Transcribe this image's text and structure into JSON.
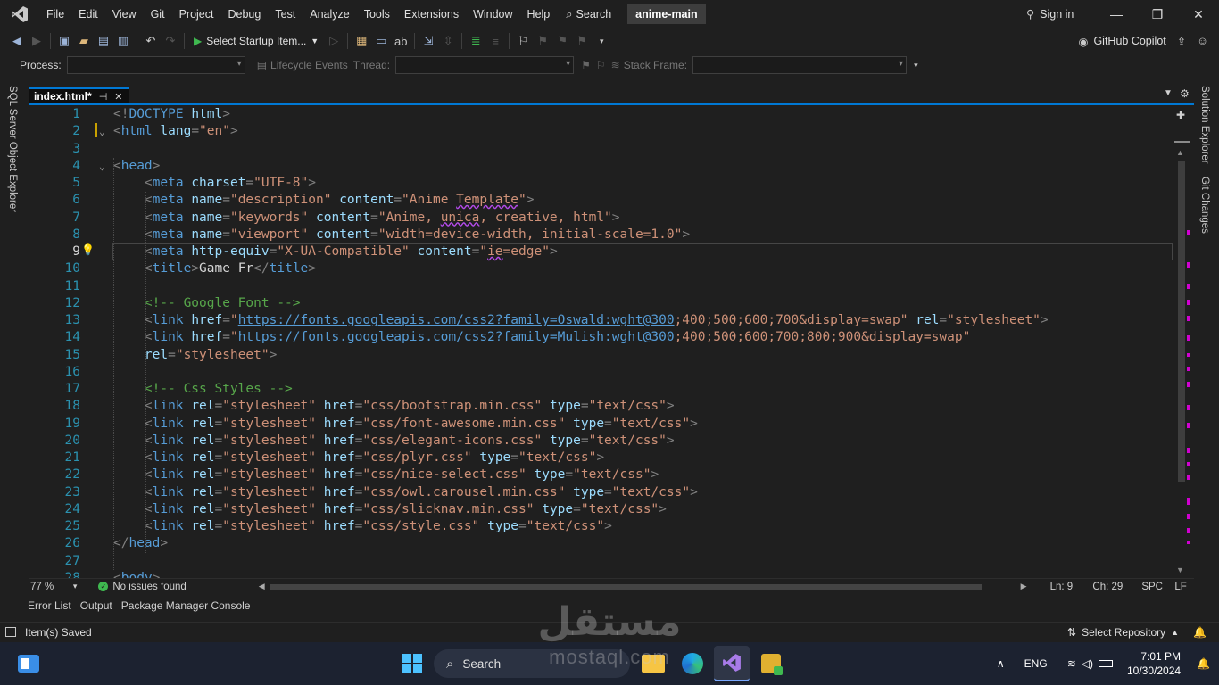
{
  "menubar": {
    "items": [
      "File",
      "Edit",
      "View",
      "Git",
      "Project",
      "Debug",
      "Test",
      "Analyze",
      "Tools",
      "Extensions",
      "Window",
      "Help"
    ],
    "search_label": "Search",
    "solution_name": "anime-main",
    "signin_label": "Sign in"
  },
  "toolbar": {
    "startup_label": "Select Startup Item...",
    "copilot_label": "GitHub Copilot"
  },
  "debugbar": {
    "process_label": "Process:",
    "lifecycle_label": "Lifecycle Events",
    "thread_label": "Thread:",
    "stackframe_label": "Stack Frame:"
  },
  "rails": {
    "left": "SQL Server Object Explorer",
    "right_1": "Solution Explorer",
    "right_2": "Git Changes"
  },
  "tab": {
    "label": "index.html*"
  },
  "editor": {
    "current_line": 9,
    "lines": [
      [
        [
          "p",
          "<!"
        ],
        [
          "t",
          "DOCTYPE"
        ],
        [
          "x",
          " "
        ],
        [
          "a",
          "html"
        ],
        [
          "p",
          ">"
        ]
      ],
      [
        [
          "p",
          "<"
        ],
        [
          "t",
          "html"
        ],
        [
          "x",
          " "
        ],
        [
          "a",
          "lang"
        ],
        [
          "p",
          "="
        ],
        [
          "v",
          "\"en\""
        ],
        [
          "p",
          ">"
        ]
      ],
      [],
      [
        [
          "p",
          "<"
        ],
        [
          "t",
          "head"
        ],
        [
          "p",
          ">"
        ]
      ],
      [
        [
          "x",
          "    "
        ],
        [
          "p",
          "<"
        ],
        [
          "t",
          "meta"
        ],
        [
          "x",
          " "
        ],
        [
          "a",
          "charset"
        ],
        [
          "p",
          "="
        ],
        [
          "v",
          "\"UTF-8\""
        ],
        [
          "p",
          ">"
        ]
      ],
      [
        [
          "x",
          "    "
        ],
        [
          "p",
          "<"
        ],
        [
          "t",
          "meta"
        ],
        [
          "x",
          " "
        ],
        [
          "a",
          "name"
        ],
        [
          "p",
          "="
        ],
        [
          "v",
          "\"description\""
        ],
        [
          "x",
          " "
        ],
        [
          "a",
          "content"
        ],
        [
          "p",
          "="
        ],
        [
          "v",
          "\"Anime "
        ],
        [
          "vs",
          "Template"
        ],
        [
          "v",
          "\""
        ],
        [
          "p",
          ">"
        ]
      ],
      [
        [
          "x",
          "    "
        ],
        [
          "p",
          "<"
        ],
        [
          "t",
          "meta"
        ],
        [
          "x",
          " "
        ],
        [
          "a",
          "name"
        ],
        [
          "p",
          "="
        ],
        [
          "v",
          "\"keywords\""
        ],
        [
          "x",
          " "
        ],
        [
          "a",
          "content"
        ],
        [
          "p",
          "="
        ],
        [
          "v",
          "\"Anime, "
        ],
        [
          "vs",
          "unica"
        ],
        [
          "v",
          ", creative, html\""
        ],
        [
          "p",
          ">"
        ]
      ],
      [
        [
          "x",
          "    "
        ],
        [
          "p",
          "<"
        ],
        [
          "t",
          "meta"
        ],
        [
          "x",
          " "
        ],
        [
          "a",
          "name"
        ],
        [
          "p",
          "="
        ],
        [
          "v",
          "\"viewport\""
        ],
        [
          "x",
          " "
        ],
        [
          "a",
          "content"
        ],
        [
          "p",
          "="
        ],
        [
          "v",
          "\"width=device-width, initial-scale=1.0\""
        ],
        [
          "p",
          ">"
        ]
      ],
      [
        [
          "x",
          "    "
        ],
        [
          "p",
          "<"
        ],
        [
          "t",
          "meta"
        ],
        [
          "x",
          " "
        ],
        [
          "a",
          "http-equiv"
        ],
        [
          "p",
          "="
        ],
        [
          "v",
          "\"X-UA-Compatible\""
        ],
        [
          "x",
          " "
        ],
        [
          "a",
          "content"
        ],
        [
          "p",
          "="
        ],
        [
          "v",
          "\""
        ],
        [
          "vs",
          "ie"
        ],
        [
          "v",
          "=edge\""
        ],
        [
          "p",
          ">"
        ]
      ],
      [
        [
          "x",
          "    "
        ],
        [
          "p",
          "<"
        ],
        [
          "t",
          "title"
        ],
        [
          "p",
          ">"
        ],
        [
          "x",
          "Game Fr"
        ],
        [
          "p",
          "</"
        ],
        [
          "t",
          "title"
        ],
        [
          "p",
          ">"
        ]
      ],
      [],
      [
        [
          "x",
          "    "
        ],
        [
          "c",
          "<!-- Google Font -->"
        ]
      ],
      [
        [
          "x",
          "    "
        ],
        [
          "p",
          "<"
        ],
        [
          "t",
          "link"
        ],
        [
          "x",
          " "
        ],
        [
          "a",
          "href"
        ],
        [
          "p",
          "="
        ],
        [
          "v",
          "\""
        ],
        [
          "l",
          "https://fonts.googleapis.com/css2?family=Oswald:wght@300"
        ],
        [
          "v",
          ";400;500;600;700&display=swap\""
        ],
        [
          "x",
          " "
        ],
        [
          "a",
          "rel"
        ],
        [
          "p",
          "="
        ],
        [
          "v",
          "\"stylesheet\""
        ],
        [
          "p",
          ">"
        ]
      ],
      [
        [
          "x",
          "    "
        ],
        [
          "p",
          "<"
        ],
        [
          "t",
          "link"
        ],
        [
          "x",
          " "
        ],
        [
          "a",
          "href"
        ],
        [
          "p",
          "="
        ],
        [
          "v",
          "\""
        ],
        [
          "l",
          "https://fonts.googleapis.com/css2?family=Mulish:wght@300"
        ],
        [
          "v",
          ";400;500;600;700;800;900&display=swap\""
        ]
      ],
      [
        [
          "x",
          "    "
        ],
        [
          "a",
          "rel"
        ],
        [
          "p",
          "="
        ],
        [
          "v",
          "\"stylesheet\""
        ],
        [
          "p",
          ">"
        ]
      ],
      [],
      [
        [
          "x",
          "    "
        ],
        [
          "c",
          "<!-- Css Styles -->"
        ]
      ],
      [
        [
          "x",
          "    "
        ],
        [
          "p",
          "<"
        ],
        [
          "t",
          "link"
        ],
        [
          "x",
          " "
        ],
        [
          "a",
          "rel"
        ],
        [
          "p",
          "="
        ],
        [
          "v",
          "\"stylesheet\""
        ],
        [
          "x",
          " "
        ],
        [
          "a",
          "href"
        ],
        [
          "p",
          "="
        ],
        [
          "v",
          "\"css/bootstrap.min.css\""
        ],
        [
          "x",
          " "
        ],
        [
          "a",
          "type"
        ],
        [
          "p",
          "="
        ],
        [
          "v",
          "\"text/css\""
        ],
        [
          "p",
          ">"
        ]
      ],
      [
        [
          "x",
          "    "
        ],
        [
          "p",
          "<"
        ],
        [
          "t",
          "link"
        ],
        [
          "x",
          " "
        ],
        [
          "a",
          "rel"
        ],
        [
          "p",
          "="
        ],
        [
          "v",
          "\"stylesheet\""
        ],
        [
          "x",
          " "
        ],
        [
          "a",
          "href"
        ],
        [
          "p",
          "="
        ],
        [
          "v",
          "\"css/font-awesome.min.css\""
        ],
        [
          "x",
          " "
        ],
        [
          "a",
          "type"
        ],
        [
          "p",
          "="
        ],
        [
          "v",
          "\"text/css\""
        ],
        [
          "p",
          ">"
        ]
      ],
      [
        [
          "x",
          "    "
        ],
        [
          "p",
          "<"
        ],
        [
          "t",
          "link"
        ],
        [
          "x",
          " "
        ],
        [
          "a",
          "rel"
        ],
        [
          "p",
          "="
        ],
        [
          "v",
          "\"stylesheet\""
        ],
        [
          "x",
          " "
        ],
        [
          "a",
          "href"
        ],
        [
          "p",
          "="
        ],
        [
          "v",
          "\"css/elegant-icons.css\""
        ],
        [
          "x",
          " "
        ],
        [
          "a",
          "type"
        ],
        [
          "p",
          "="
        ],
        [
          "v",
          "\"text/css\""
        ],
        [
          "p",
          ">"
        ]
      ],
      [
        [
          "x",
          "    "
        ],
        [
          "p",
          "<"
        ],
        [
          "t",
          "link"
        ],
        [
          "x",
          " "
        ],
        [
          "a",
          "rel"
        ],
        [
          "p",
          "="
        ],
        [
          "v",
          "\"stylesheet\""
        ],
        [
          "x",
          " "
        ],
        [
          "a",
          "href"
        ],
        [
          "p",
          "="
        ],
        [
          "v",
          "\"css/plyr.css\""
        ],
        [
          "x",
          " "
        ],
        [
          "a",
          "type"
        ],
        [
          "p",
          "="
        ],
        [
          "v",
          "\"text/css\""
        ],
        [
          "p",
          ">"
        ]
      ],
      [
        [
          "x",
          "    "
        ],
        [
          "p",
          "<"
        ],
        [
          "t",
          "link"
        ],
        [
          "x",
          " "
        ],
        [
          "a",
          "rel"
        ],
        [
          "p",
          "="
        ],
        [
          "v",
          "\"stylesheet\""
        ],
        [
          "x",
          " "
        ],
        [
          "a",
          "href"
        ],
        [
          "p",
          "="
        ],
        [
          "v",
          "\"css/nice-select.css\""
        ],
        [
          "x",
          " "
        ],
        [
          "a",
          "type"
        ],
        [
          "p",
          "="
        ],
        [
          "v",
          "\"text/css\""
        ],
        [
          "p",
          ">"
        ]
      ],
      [
        [
          "x",
          "    "
        ],
        [
          "p",
          "<"
        ],
        [
          "t",
          "link"
        ],
        [
          "x",
          " "
        ],
        [
          "a",
          "rel"
        ],
        [
          "p",
          "="
        ],
        [
          "v",
          "\"stylesheet\""
        ],
        [
          "x",
          " "
        ],
        [
          "a",
          "href"
        ],
        [
          "p",
          "="
        ],
        [
          "v",
          "\"css/owl.carousel.min.css\""
        ],
        [
          "x",
          " "
        ],
        [
          "a",
          "type"
        ],
        [
          "p",
          "="
        ],
        [
          "v",
          "\"text/css\""
        ],
        [
          "p",
          ">"
        ]
      ],
      [
        [
          "x",
          "    "
        ],
        [
          "p",
          "<"
        ],
        [
          "t",
          "link"
        ],
        [
          "x",
          " "
        ],
        [
          "a",
          "rel"
        ],
        [
          "p",
          "="
        ],
        [
          "v",
          "\"stylesheet\""
        ],
        [
          "x",
          " "
        ],
        [
          "a",
          "href"
        ],
        [
          "p",
          "="
        ],
        [
          "v",
          "\"css/slicknav.min.css\""
        ],
        [
          "x",
          " "
        ],
        [
          "a",
          "type"
        ],
        [
          "p",
          "="
        ],
        [
          "v",
          "\"text/css\""
        ],
        [
          "p",
          ">"
        ]
      ],
      [
        [
          "x",
          "    "
        ],
        [
          "p",
          "<"
        ],
        [
          "t",
          "link"
        ],
        [
          "x",
          " "
        ],
        [
          "a",
          "rel"
        ],
        [
          "p",
          "="
        ],
        [
          "v",
          "\"stylesheet\""
        ],
        [
          "x",
          " "
        ],
        [
          "a",
          "href"
        ],
        [
          "p",
          "="
        ],
        [
          "v",
          "\"css/style.css\""
        ],
        [
          "x",
          " "
        ],
        [
          "a",
          "type"
        ],
        [
          "p",
          "="
        ],
        [
          "v",
          "\"text/css\""
        ],
        [
          "p",
          ">"
        ]
      ],
      [
        [
          "p",
          "</"
        ],
        [
          "t",
          "head"
        ],
        [
          "p",
          ">"
        ]
      ],
      [],
      [
        [
          "p",
          "<"
        ],
        [
          "t",
          "body"
        ],
        [
          "p",
          ">"
        ]
      ]
    ]
  },
  "editor_status": {
    "zoom": "77 %",
    "issues": "No issues found",
    "line": "Ln: 9",
    "col": "Ch: 29",
    "whitespace": "SPC",
    "eol": "LF"
  },
  "bottom_tabs": [
    "Error List",
    "Output",
    "Package Manager Console"
  ],
  "statusbar": {
    "message": "Item(s) Saved",
    "repo": "Select Repository"
  },
  "taskbar": {
    "search_label": "Search",
    "lang": "ENG",
    "time": "7:01 PM",
    "date": "10/30/2024"
  },
  "watermark": {
    "arabic": "مستقل",
    "latin": "mostaql.com"
  },
  "colors": {
    "accent": "#0078d4",
    "tag": "#569cd6",
    "attribute": "#9cdcfe",
    "value": "#ce9178",
    "comment": "#57a64a",
    "line_number": "#2b91af",
    "scroll_marker": "#d000d0"
  }
}
